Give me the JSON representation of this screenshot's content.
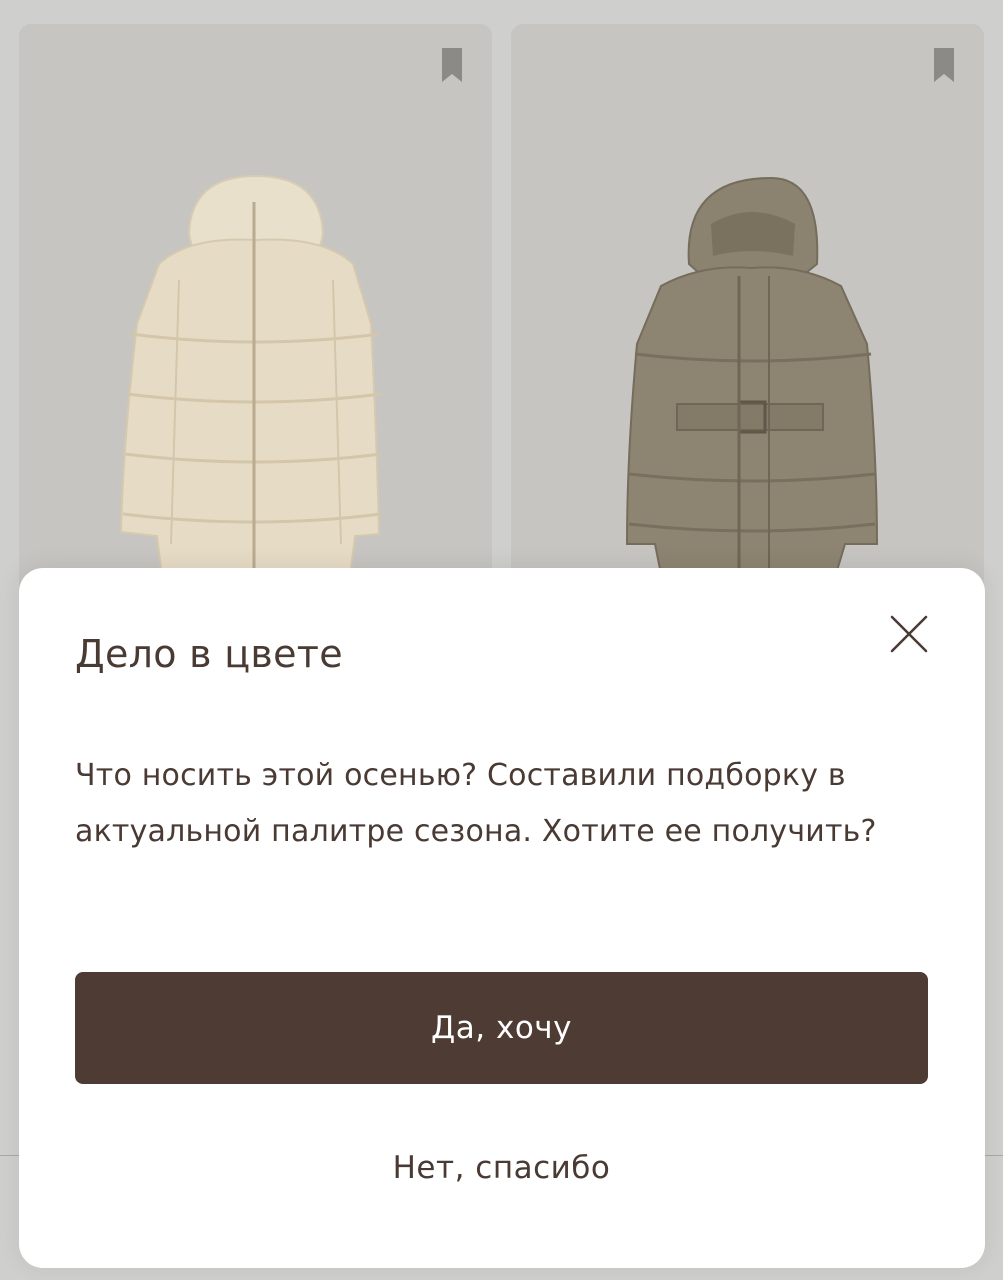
{
  "products": [
    {
      "icon": "bookmark-icon",
      "image": "cream-puffer-coat-image",
      "color": "#e6dcc6"
    },
    {
      "icon": "bookmark-icon",
      "image": "khaki-belted-puffer-coat-image",
      "color": "#8d8471"
    }
  ],
  "modal": {
    "title": "Дело в цвете",
    "body": "Что носить этой осенью? Составили подборку в актуальной палитре сезона. Хотите ее получить?",
    "primary_label": "Да, хочу",
    "secondary_label": "Нет, спасибо",
    "close_icon": "close-icon"
  },
  "colors": {
    "accent": "#4e3b33",
    "text": "#4a3a34",
    "background": "#c6c5c2"
  }
}
